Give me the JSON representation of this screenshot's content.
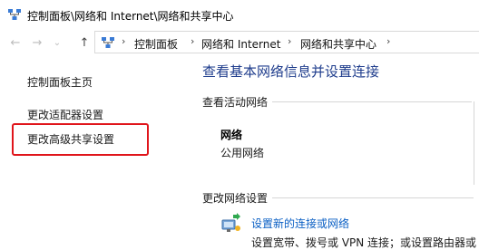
{
  "window": {
    "title": "控制面板\\网络和 Internet\\网络和共享中心",
    "icon": "network-icon"
  },
  "nav": {
    "back_icon": "←",
    "forward_icon": "→",
    "recent_icon": "⌄",
    "up_icon": "↑",
    "separator": "›"
  },
  "breadcrumbs": [
    "控制面板",
    "网络和 Internet",
    "网络和共享中心"
  ],
  "sidebar": {
    "items": [
      {
        "label": "控制面板主页"
      },
      {
        "label": "更改适配器设置"
      },
      {
        "label": "更改高级共享设置"
      }
    ],
    "highlight_color": "#e0151b"
  },
  "main": {
    "title": "查看基本网络信息并设置连接",
    "active_networks_label": "查看活动网络",
    "network": {
      "name": "网络",
      "type": "公用网络"
    },
    "change_settings_label": "更改网络设置",
    "setup_link": "设置新的连接或网络",
    "setup_desc": "设置宽带、拨号或 VPN 连接；或设置路由器或"
  },
  "colors": {
    "title_blue": "#1e3c8c",
    "link_blue": "#0a5fc4"
  }
}
